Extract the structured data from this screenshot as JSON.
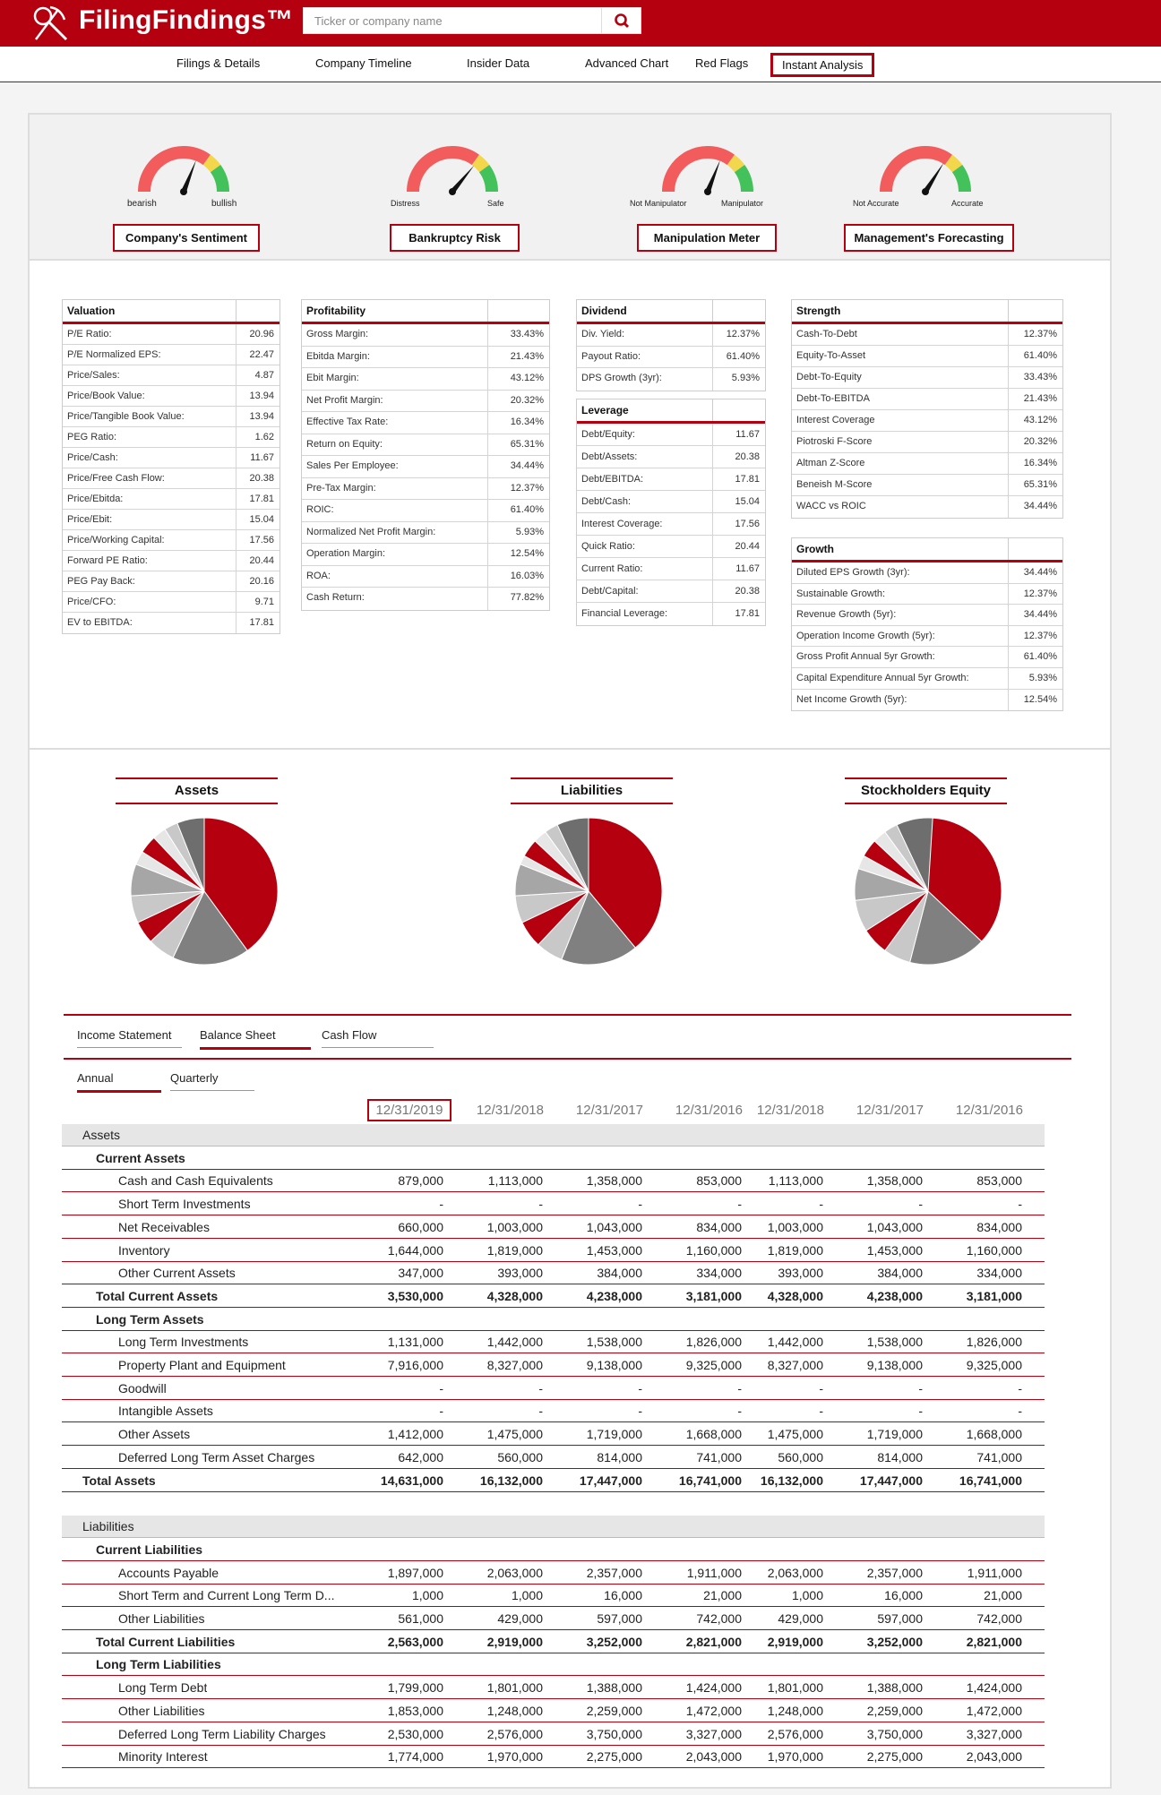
{
  "app": {
    "name": "FilingFindings™"
  },
  "search": {
    "placeholder": "Ticker or company name"
  },
  "nav": {
    "items": [
      "Filings & Details",
      "Company Timeline",
      "Insider Data",
      "Advanced Chart",
      "Red Flags",
      "Instant Analysis"
    ],
    "active": "Instant Analysis"
  },
  "gauges": [
    {
      "title": "Company's Sentiment",
      "left": "bearish",
      "right": "bullish",
      "needle": 0.62
    },
    {
      "title": "Bankruptcy Risk",
      "left": "Distress",
      "right": "Safe",
      "needle": 0.72
    },
    {
      "title": "Manipulation Meter",
      "left": "Not Manipulator",
      "right": "Manipulator",
      "needle": 0.62
    },
    {
      "title": "Management's Forecasting",
      "left": "Not Accurate",
      "right": "Accurate",
      "needle": 0.68
    }
  ],
  "metrics": {
    "valuation": {
      "title": "Valuation",
      "rows": [
        [
          "P/E Ratio:",
          "20.96"
        ],
        [
          "P/E Normalized EPS:",
          "22.47"
        ],
        [
          "Price/Sales:",
          "4.87"
        ],
        [
          "Price/Book Value:",
          "13.94"
        ],
        [
          "Price/Tangible Book Value:",
          "13.94"
        ],
        [
          "PEG Ratio:",
          "1.62"
        ],
        [
          "Price/Cash:",
          "11.67"
        ],
        [
          "Price/Free Cash Flow:",
          "20.38"
        ],
        [
          "Price/Ebitda:",
          "17.81"
        ],
        [
          "Price/Ebit:",
          "15.04"
        ],
        [
          "Price/Working Capital:",
          "17.56"
        ],
        [
          "Forward PE Ratio:",
          "20.44"
        ],
        [
          "PEG Pay Back:",
          "20.16"
        ],
        [
          "Price/CFO:",
          "9.71"
        ],
        [
          "EV to EBITDA:",
          "17.81"
        ]
      ]
    },
    "profitability": {
      "title": "Profitability",
      "rows": [
        [
          "Gross Margin:",
          "33.43%"
        ],
        [
          "Ebitda Margin:",
          "21.43%"
        ],
        [
          "Ebit Margin:",
          "43.12%"
        ],
        [
          "Net Profit Margin:",
          "20.32%"
        ],
        [
          "Effective Tax Rate:",
          "16.34%"
        ],
        [
          "Return on Equity:",
          "65.31%"
        ],
        [
          "Sales Per Employee:",
          "34.44%"
        ],
        [
          "Pre-Tax Margin:",
          "12.37%"
        ],
        [
          "ROIC:",
          "61.40%"
        ],
        [
          "Normalized Net Profit Margin:",
          "5.93%"
        ],
        [
          "Operation Margin:",
          "12.54%"
        ],
        [
          "ROA:",
          "16.03%"
        ],
        [
          "Cash Return:",
          "77.82%"
        ]
      ]
    },
    "dividend": {
      "title": "Dividend",
      "rows": [
        [
          "Div. Yield:",
          "12.37%"
        ],
        [
          "Payout Ratio:",
          "61.40%"
        ],
        [
          "DPS Growth (3yr):",
          "5.93%"
        ]
      ]
    },
    "leverage": {
      "title": "Leverage",
      "rows": [
        [
          "Debt/Equity:",
          "11.67"
        ],
        [
          "Debt/Assets:",
          "20.38"
        ],
        [
          "Debt/EBITDA:",
          "17.81"
        ],
        [
          "Debt/Cash:",
          "15.04"
        ],
        [
          "Interest Coverage:",
          "17.56"
        ],
        [
          "Quick Ratio:",
          "20.44"
        ],
        [
          "Current Ratio:",
          "11.67"
        ],
        [
          "Debt/Capital:",
          "20.38"
        ],
        [
          "Financial Leverage:",
          "17.81"
        ]
      ]
    },
    "strength": {
      "title": "Strength",
      "rows": [
        [
          "Cash-To-Debt",
          "12.37%"
        ],
        [
          "Equity-To-Asset",
          "61.40%"
        ],
        [
          "Debt-To-Equity",
          "33.43%"
        ],
        [
          "Debt-To-EBITDA",
          "21.43%"
        ],
        [
          "Interest Coverage",
          "43.12%"
        ],
        [
          "Piotroski F-Score",
          "20.32%"
        ],
        [
          "Altman Z-Score",
          "16.34%"
        ],
        [
          "Beneish M-Score",
          "65.31%"
        ],
        [
          "WACC vs ROIC",
          "34.44%"
        ]
      ]
    },
    "growth": {
      "title": "Growth",
      "rows": [
        [
          "Diluted EPS Growth (3yr):",
          "34.44%"
        ],
        [
          "Sustainable Growth:",
          "12.37%"
        ],
        [
          "Revenue Growth (5yr):",
          "34.44%"
        ],
        [
          "Operation Income Growth (5yr):",
          "12.37%"
        ],
        [
          "Gross Profit Annual 5yr Growth:",
          "61.40%"
        ],
        [
          "Capital Expenditure Annual 5yr Growth:",
          "5.93%"
        ],
        [
          "Net Income Growth (5yr):",
          "12.54%"
        ]
      ]
    }
  },
  "pies": {
    "titles": [
      "Assets",
      "Liabilities",
      "Stockholders Equity"
    ],
    "colors": {
      "red": "#b5010f",
      "dark": "#808080",
      "light": "#c8c8c8",
      "mid": "#a6a6a6",
      "darker": "#6e6e6e",
      "white": "#e6e6e6"
    }
  },
  "statement_tabs": {
    "items": [
      "Income Statement",
      "Balance Sheet",
      "Cash Flow"
    ],
    "active": "Balance Sheet"
  },
  "period_tabs": {
    "items": [
      "Annual",
      "Quarterly"
    ],
    "active": "Annual"
  },
  "columns": [
    "12/31/2019",
    "12/31/2018",
    "12/31/2017",
    "12/31/2016",
    "12/31/2018",
    "12/31/2017",
    "12/31/2016"
  ],
  "rows": [
    {
      "label": "Assets",
      "type": "section",
      "indent": 0
    },
    {
      "label": "Current Assets",
      "type": "subhead",
      "indent": 1
    },
    {
      "label": "Cash and Cash Equivalents",
      "indent": 2,
      "values": [
        "879,000",
        "1,113,000",
        "1,358,000",
        "853,000",
        "1,113,000",
        "1,358,000",
        "853,000"
      ]
    },
    {
      "label": "Short Term Investments",
      "indent": 2,
      "values": [
        "-",
        "-",
        "-",
        "-",
        "-",
        "-",
        "-"
      ]
    },
    {
      "label": "Net Receivables",
      "indent": 2,
      "values": [
        "660,000",
        "1,003,000",
        "1,043,000",
        "834,000",
        "1,003,000",
        "1,043,000",
        "834,000"
      ]
    },
    {
      "label": "Inventory",
      "indent": 2,
      "values": [
        "1,644,000",
        "1,819,000",
        "1,453,000",
        "1,160,000",
        "1,819,000",
        "1,453,000",
        "1,160,000"
      ]
    },
    {
      "label": "Other Current Assets",
      "indent": 2,
      "values": [
        "347,000",
        "393,000",
        "384,000",
        "334,000",
        "393,000",
        "384,000",
        "334,000"
      ]
    },
    {
      "label": "Total Current Assets",
      "type": "total",
      "indent": 1,
      "values": [
        "3,530,000",
        "4,328,000",
        "4,238,000",
        "3,181,000",
        "4,328,000",
        "4,238,000",
        "3,181,000"
      ]
    },
    {
      "label": "Long Term Assets",
      "type": "subhead",
      "indent": 1
    },
    {
      "label": "Long Term Investments",
      "indent": 2,
      "values": [
        "1,131,000",
        "1,442,000",
        "1,538,000",
        "1,826,000",
        "1,442,000",
        "1,538,000",
        "1,826,000"
      ]
    },
    {
      "label": "Property Plant and Equipment",
      "indent": 2,
      "values": [
        "7,916,000",
        "8,327,000",
        "9,138,000",
        "9,325,000",
        "8,327,000",
        "9,138,000",
        "9,325,000"
      ]
    },
    {
      "label": "Goodwill",
      "indent": 2,
      "values": [
        "-",
        "-",
        "-",
        "-",
        "-",
        "-",
        "-"
      ]
    },
    {
      "label": "Intangible Assets",
      "indent": 2,
      "values": [
        "-",
        "-",
        "-",
        "-",
        "-",
        "-",
        "-"
      ]
    },
    {
      "label": "Other Assets",
      "indent": 2,
      "values": [
        "1,412,000",
        "1,475,000",
        "1,719,000",
        "1,668,000",
        "1,475,000",
        "1,719,000",
        "1,668,000"
      ]
    },
    {
      "label": "Deferred Long Term Asset Charges",
      "indent": 2,
      "values": [
        "642,000",
        "560,000",
        "814,000",
        "741,000",
        "560,000",
        "814,000",
        "741,000"
      ]
    },
    {
      "label": "Total Assets",
      "type": "total",
      "indent": 0,
      "values": [
        "14,631,000",
        "16,132,000",
        "17,447,000",
        "16,741,000",
        "16,132,000",
        "17,447,000",
        "16,741,000"
      ]
    },
    {
      "label": "Liabilities",
      "type": "section",
      "indent": 0
    },
    {
      "label": "Current Liabilities",
      "type": "subhead",
      "indent": 1
    },
    {
      "label": "Accounts Payable",
      "indent": 2,
      "values": [
        "1,897,000",
        "2,063,000",
        "2,357,000",
        "1,911,000",
        "2,063,000",
        "2,357,000",
        "1,911,000"
      ]
    },
    {
      "label": "Short Term and Current Long Term D...",
      "indent": 2,
      "values": [
        "1,000",
        "1,000",
        "16,000",
        "21,000",
        "1,000",
        "16,000",
        "21,000"
      ]
    },
    {
      "label": "Other Liabilities",
      "indent": 2,
      "values": [
        "561,000",
        "429,000",
        "597,000",
        "742,000",
        "429,000",
        "597,000",
        "742,000"
      ]
    },
    {
      "label": "Total Current Liabilities",
      "type": "total",
      "indent": 1,
      "values": [
        "2,563,000",
        "2,919,000",
        "3,252,000",
        "2,821,000",
        "2,919,000",
        "3,252,000",
        "2,821,000"
      ]
    },
    {
      "label": "Long Term Liabilities",
      "type": "subhead",
      "indent": 1
    },
    {
      "label": "Long Term Debt",
      "indent": 2,
      "values": [
        "1,799,000",
        "1,801,000",
        "1,388,000",
        "1,424,000",
        "1,801,000",
        "1,388,000",
        "1,424,000"
      ]
    },
    {
      "label": "Other Liabilities",
      "indent": 2,
      "values": [
        "1,853,000",
        "1,248,000",
        "2,259,000",
        "1,472,000",
        "1,248,000",
        "2,259,000",
        "1,472,000"
      ]
    },
    {
      "label": "Deferred Long Term Liability Charges",
      "indent": 2,
      "values": [
        "2,530,000",
        "2,576,000",
        "3,750,000",
        "3,327,000",
        "2,576,000",
        "3,750,000",
        "3,327,000"
      ]
    },
    {
      "label": "Minority Interest",
      "indent": 2,
      "values": [
        "1,774,000",
        "1,970,000",
        "2,275,000",
        "2,043,000",
        "1,970,000",
        "2,275,000",
        "2,043,000"
      ]
    }
  ]
}
